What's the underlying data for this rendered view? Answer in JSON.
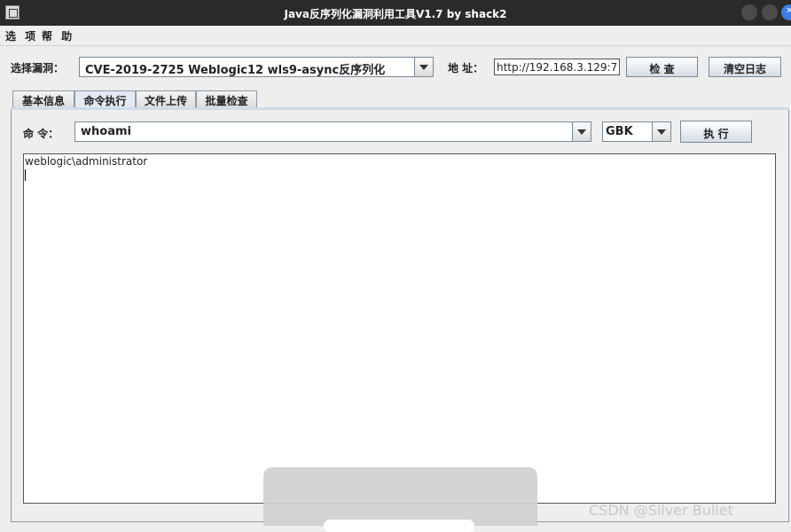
{
  "window": {
    "title": "Java反序列化漏洞利用工具V1.7 by shack2"
  },
  "menu": {
    "items": [
      "选 项",
      "帮 助"
    ]
  },
  "top": {
    "vuln_label": "选择漏洞：",
    "vuln_value": "CVE-2019-2725 Weblogic12 wls9-async反序列化",
    "address_label": "地 址：",
    "address_value": "http://192.168.3.129:7",
    "check_button": "检 查",
    "clear_log_button": "清空日志"
  },
  "tabs": [
    "基本信息",
    "命令执行",
    "文件上传",
    "批量检查"
  ],
  "active_tab": 1,
  "command": {
    "label": "命 令：",
    "value": "whoami",
    "encoding": "GBK",
    "exec_button": "执 行"
  },
  "output": {
    "text": "weblogic\\administrator"
  },
  "watermark": "CSDN @Silver    Bullet"
}
